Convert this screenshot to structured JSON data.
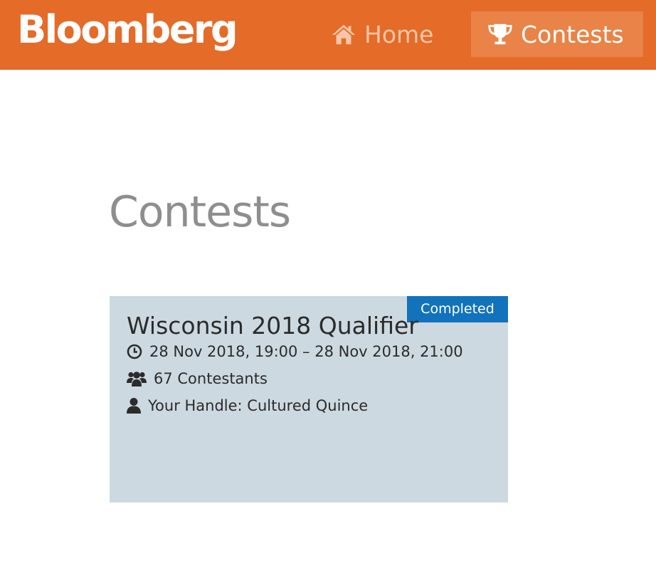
{
  "navbar": {
    "brand": "Bloomberg",
    "items": [
      {
        "label": "Home",
        "icon": "home-icon",
        "active": false
      },
      {
        "label": "Contests",
        "icon": "trophy-icon",
        "active": true
      }
    ],
    "colors": {
      "background": "#e46b28",
      "active_item": "#e98347",
      "inactive_text": "#f7c6a8"
    }
  },
  "main": {
    "title": "Contests",
    "contests": [
      {
        "name": "Wisconsin 2018 Qualifier",
        "status": "Completed",
        "time_range": "28 Nov 2018, 19:00 – 28 Nov 2018, 21:00",
        "contestants": "67 Contestants",
        "handle": "Your Handle: Cultured Quince",
        "icons": {
          "time": "clock-icon",
          "contestants": "users-icon",
          "handle": "user-icon"
        },
        "colors": {
          "card": "#cdd9e1",
          "badge": "#1272bc"
        }
      }
    ]
  }
}
